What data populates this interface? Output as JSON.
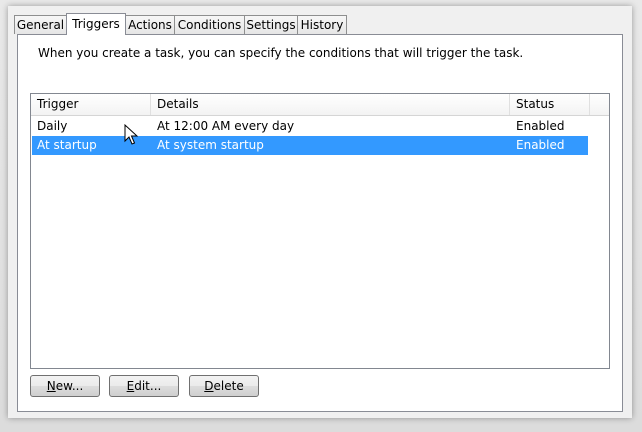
{
  "tabs": [
    {
      "label": "General",
      "active": false
    },
    {
      "label": "Triggers",
      "active": true
    },
    {
      "label": "Actions",
      "active": false
    },
    {
      "label": "Conditions",
      "active": false
    },
    {
      "label": "Settings",
      "active": false
    },
    {
      "label": "History",
      "active": false
    }
  ],
  "intro_text": "When you create a task, you can specify the conditions that will trigger the task.",
  "table": {
    "columns": [
      "Trigger",
      "Details",
      "Status"
    ],
    "rows": [
      {
        "trigger": "Daily",
        "details": "At 12:00 AM every day",
        "status": "Enabled",
        "selected": false
      },
      {
        "trigger": "At startup",
        "details": "At system startup",
        "status": "Enabled",
        "selected": true
      }
    ]
  },
  "buttons": {
    "new": {
      "mnemonic": "N",
      "rest": "ew..."
    },
    "edit": {
      "mnemonic": "E",
      "rest": "dit..."
    },
    "delete": {
      "mnemonic": "D",
      "rest": "elete"
    }
  },
  "colors": {
    "selection": "#3399ff",
    "panel_bg": "#f0f0f0"
  },
  "icons": [
    "mouse-pointer-icon"
  ]
}
